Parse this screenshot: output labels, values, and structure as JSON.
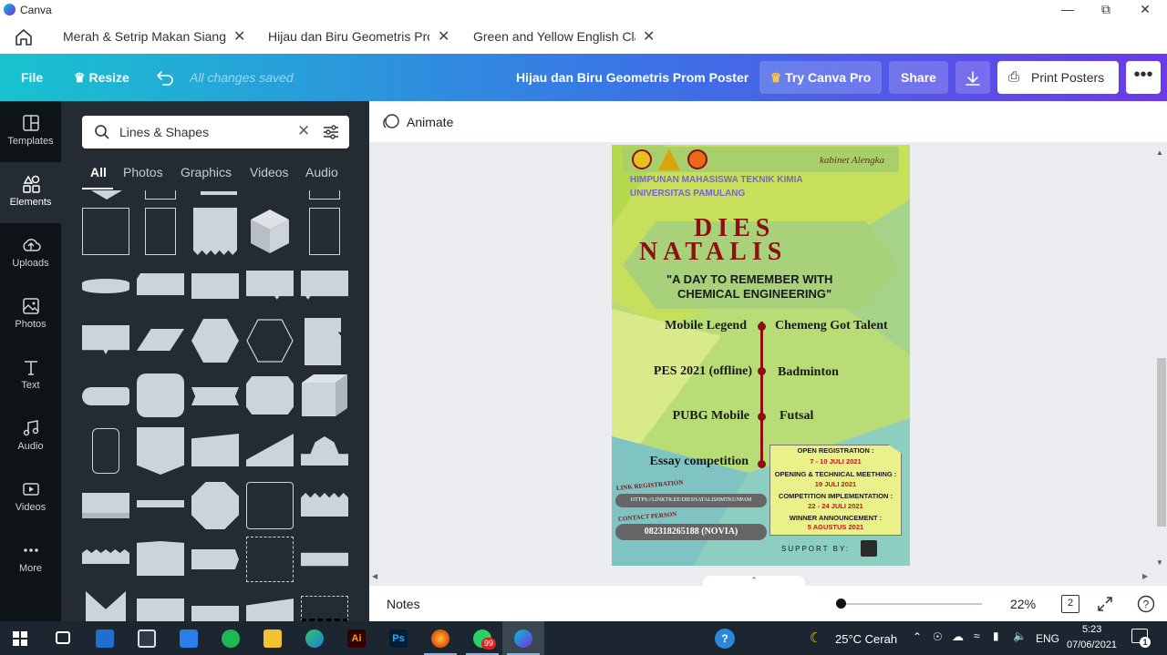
{
  "window": {
    "app_name": "Canva"
  },
  "tabs": [
    {
      "label": "Merah & Setrip Makan Siang"
    },
    {
      "label": "Hijau dan Biru Geometris Pro"
    },
    {
      "label": "Green and Yellow English Cla"
    }
  ],
  "toolbar": {
    "file": "File",
    "resize": "Resize",
    "saved_status": "All changes saved",
    "doc_title": "Hijau dan Biru Geometris Prom Poster",
    "try_pro": "Try Canva Pro",
    "share": "Share",
    "print": "Print Posters"
  },
  "rail": [
    {
      "label": "Templates",
      "icon": "templates-icon"
    },
    {
      "label": "Elements",
      "icon": "elements-icon"
    },
    {
      "label": "Uploads",
      "icon": "uploads-icon"
    },
    {
      "label": "Photos",
      "icon": "photos-icon"
    },
    {
      "label": "Text",
      "icon": "text-icon"
    },
    {
      "label": "Audio",
      "icon": "audio-icon"
    },
    {
      "label": "Videos",
      "icon": "videos-icon"
    },
    {
      "label": "More",
      "icon": "more-icon"
    }
  ],
  "panel": {
    "search_value": "Lines & Shapes",
    "tabs": [
      "All",
      "Photos",
      "Graphics",
      "Videos",
      "Audio"
    ]
  },
  "workspace": {
    "animate": "Animate",
    "notes": "Notes",
    "zoom": "22%",
    "page_count": "2"
  },
  "poster": {
    "kabinet": "kabinet Alengka",
    "org_line1": "HIMPUNAN MAHASISWA TEKNIK KIMIA",
    "org_line2": "UNIVERSITAS PAMULANG",
    "title_line1": "DIES",
    "title_line2": "NATALIS",
    "tagline1": "\"A DAY TO REMEMBER WITH",
    "tagline2": "CHEMICAL ENGINEERING\"",
    "events_left": [
      "Mobile Legend",
      "PES 2021 (offline)",
      "PUBG Mobile",
      "Essay competition"
    ],
    "events_right": [
      "Chemeng Got Talent",
      "Badminton",
      "Futsal"
    ],
    "link_label": "LINK REGISTRATION",
    "link_url": "HTTPS://LINKTR.EE/DIESNATALISHMTKUNPAM",
    "contact_label": "CONTACT PERSON",
    "contact_value": "082318265188 (NOVIA)",
    "schedule": [
      {
        "title": "OPEN REGISTRATION :",
        "date": "7 - 10 JULI 2021"
      },
      {
        "title": "OPENING & TECHNICAL MEETHING :",
        "date": "19 JULI 2021"
      },
      {
        "title": "COMPETITION IMPLEMENTATION :",
        "date": "22 - 24 JULI 2021"
      },
      {
        "title": "WINNER ANNOUNCEMENT :",
        "date": "5 AGUSTUS 2021"
      }
    ],
    "support": "SUPPORT BY:"
  },
  "taskbar": {
    "weather": "25°C  Cerah",
    "lang": "ENG",
    "time": "5:23",
    "date": "07/06/2021",
    "whatsapp_badge": "99",
    "notif_count": "1"
  },
  "colors": {
    "accent": "#7d2ae8",
    "poster_red": "#8b1010"
  }
}
